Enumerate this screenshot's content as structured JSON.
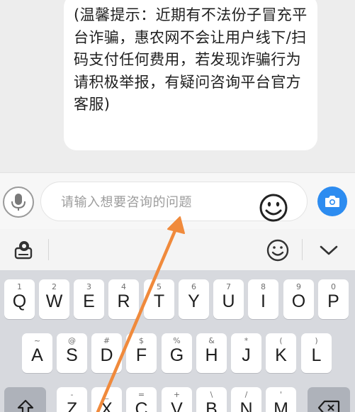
{
  "chat": {
    "message": "(温馨提示：近期有不法份子冒充平台诈骗，惠农网不会让用户线下/扫码支付任何费用，若发现诈骗行为请积极举报，有疑问咨询平台官方客服)"
  },
  "input_bar": {
    "placeholder": "请输入想要咨询的问题",
    "icons": [
      "microphone-icon",
      "emoji-icon",
      "camera-icon"
    ]
  },
  "toolbar": {
    "icons": [
      "keyboard-settings-icon",
      "smiley-icon",
      "chevron-down-icon"
    ]
  },
  "keyboard": {
    "row1": [
      {
        "key": "Q",
        "sub": "1"
      },
      {
        "key": "W",
        "sub": "2"
      },
      {
        "key": "E",
        "sub": "3"
      },
      {
        "key": "R",
        "sub": "4"
      },
      {
        "key": "T",
        "sub": "5"
      },
      {
        "key": "Y",
        "sub": "6"
      },
      {
        "key": "U",
        "sub": "7"
      },
      {
        "key": "I",
        "sub": "8"
      },
      {
        "key": "O",
        "sub": "9"
      },
      {
        "key": "P",
        "sub": "0"
      }
    ],
    "row2": [
      {
        "key": "A",
        "sub": "~"
      },
      {
        "key": "S",
        "sub": "@"
      },
      {
        "key": "D",
        "sub": "#"
      },
      {
        "key": "F",
        "sub": "$"
      },
      {
        "key": "G",
        "sub": "%"
      },
      {
        "key": "H",
        "sub": "&"
      },
      {
        "key": "J",
        "sub": "*"
      },
      {
        "key": "K",
        "sub": "("
      },
      {
        "key": "L",
        "sub": ")"
      }
    ],
    "row3": [
      {
        "key": "Z",
        "sub": "-"
      },
      {
        "key": "X",
        "sub": "_"
      },
      {
        "key": "C",
        "sub": "="
      },
      {
        "key": "V",
        "sub": "+"
      },
      {
        "key": "B",
        "sub": "\\"
      },
      {
        "key": "N",
        "sub": "/"
      },
      {
        "key": "M",
        "sub": "'"
      }
    ]
  },
  "colors": {
    "accent": "#2d8cf0",
    "annotation_arrow": "#f08a3c"
  }
}
